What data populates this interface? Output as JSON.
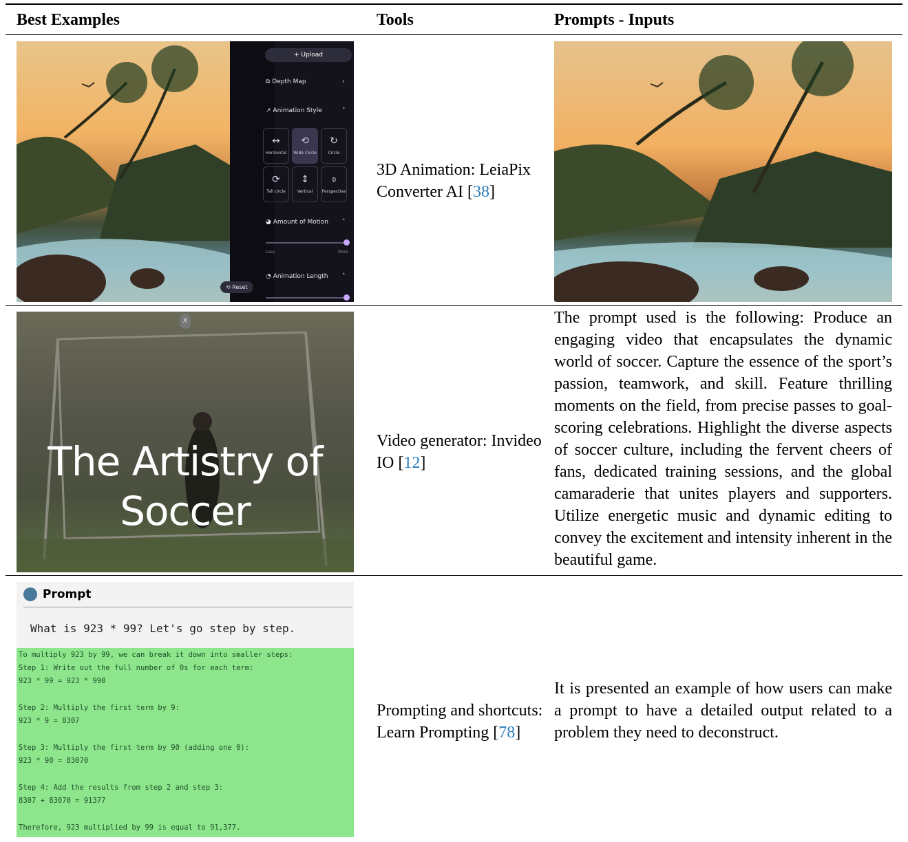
{
  "table": {
    "headers": [
      "Best Examples",
      "Tools",
      "Prompts - Inputs"
    ],
    "rows": [
      {
        "tool_main": "3D Animation: LeiaPix Converter AI [",
        "tool_ref": "38",
        "tool_end": "]",
        "ui": {
          "upload": "Upload",
          "depth_map": "Depth Map",
          "animation_style": "Animation Style",
          "tiles": [
            "Horizontal",
            "Wide Circle",
            "Circle",
            "Tall circle",
            "Vertical",
            "Perspective"
          ],
          "amount_of_motion": "Amount of Motion",
          "less": "Less",
          "more": "More",
          "animation_length": "Animation Length",
          "reset": "Reset"
        }
      },
      {
        "image_text": "The Artistry of",
        "image_text_2": "Soccer",
        "close": "X",
        "tool_main": "Video generator: Invideo IO [",
        "tool_ref": "12",
        "tool_end": "]",
        "prompt": "The prompt used is the following: Produce an engaging video that encapsulates the dynamic world of soccer.  Capture the essence of the sport’s passion, teamwork, and skill. Feature thrilling moments on the field, from precise passes to goal-scoring celebrations. Highlight the diverse aspects of soccer culture, including the fervent cheers of fans, dedicated training sessions, and the global camaraderie that unites players and supporters. Utilize energetic music and dynamic editing to convey the excitement and intensity inherent in the beautiful game."
      },
      {
        "prompt_header": "Prompt",
        "question": "What is 923 * 99? Let's go step by step.",
        "answer_lines": [
          "To multiply 923 by 99, we can break it down into smaller steps:",
          "Step 1: Write out the full number of 0s for each term:",
          "923 * 99 = 923 * 990",
          "",
          "Step 2: Multiply the first term by 9:",
          "923 * 9 = 8307",
          "",
          "Step 3: Multiply the first term by 90 (adding one 0):",
          "923 * 90 = 83070",
          "",
          "Step 4: Add the results from step 2 and step 3:",
          "8307 + 83070 = 91377",
          "",
          "Therefore, 923 multiplied by 99 is equal to 91,377."
        ],
        "tool_main": "Prompting and shortcuts: Learn Prompting [",
        "tool_ref": "78",
        "tool_end": "]",
        "prompt": "It is presented an example of how users can make a prompt to have a detailed output related to a problem they need to deconstruct."
      }
    ]
  }
}
